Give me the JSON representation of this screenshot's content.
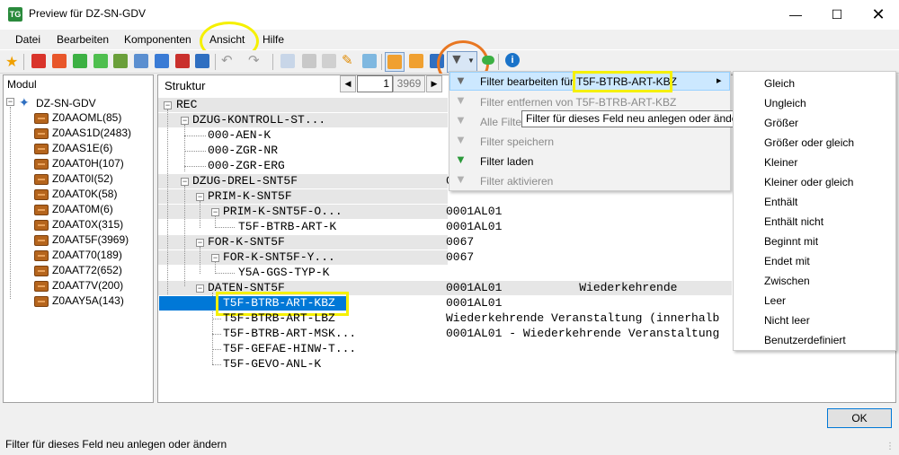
{
  "window": {
    "title": "Preview für DZ-SN-GDV",
    "icon_text": "TG",
    "controls": [
      "minimize-icon",
      "maximize-icon",
      "close-icon"
    ]
  },
  "menu": [
    "Datei",
    "Bearbeiten",
    "Komponenten",
    "Ansicht",
    "Hilfe"
  ],
  "left_panel": {
    "header": "Modul",
    "root": "DZ-SN-GDV",
    "items": [
      "Z0AAOML(85)",
      "Z0AAS1D(2483)",
      "Z0AAS1E(6)",
      "Z0AAT0H(107)",
      "Z0AAT0I(52)",
      "Z0AAT0K(58)",
      "Z0AAT0M(6)",
      "Z0AAT0X(315)",
      "Z0AAT5F(3969)",
      "Z0AAT70(189)",
      "Z0AAT72(652)",
      "Z0AAT7V(200)",
      "Z0AAY5A(143)"
    ]
  },
  "structure": {
    "header": "Struktur",
    "page_current": "1",
    "page_total": "3969",
    "nodes": [
      "REC",
      "DZUG-KONTROLL-ST...",
      "000-AEN-K",
      "000-ZGR-NR",
      "000-ZGR-ERG",
      "DZUG-DREL-SNT5F",
      "PRIM-K-SNT5F",
      "PRIM-K-SNT5F-O...",
      "T5F-BTRB-ART-K",
      "FOR-K-SNT5F",
      "FOR-K-SNT5F-Y...",
      "Y5A-GGS-TYP-K",
      "DATEN-SNT5F",
      "T5F-BTRB-ART-KBZ",
      "T5F-BTRB-ART-LBZ",
      "T5F-BTRB-ART-MSK...",
      "T5F-GEFAE-HINW-T...",
      "T5F-GEVO-ANL-K"
    ],
    "values": [
      "0",
      "0001AL01",
      "0001AL01",
      "0067",
      "0067",
      "0001AL01           Wiederkehrende",
      "0001AL01",
      "Wiederkehrende Veranstaltung (innerhalb",
      "0001AL01 - Wiederkehrende Veranstaltung"
    ]
  },
  "context_menu": {
    "edit_filter": "Filter bearbeiten für T5F-BTRB-ART-KBZ",
    "remove_filter": "Filter entfernen von T5F-BTRB-ART-KBZ",
    "all_filters": "Alle Filte",
    "save_filter": "Filter speichern",
    "load_filter": "Filter laden",
    "activate_filter": "Filter aktivieren",
    "submenu_arrow": "▸"
  },
  "tooltip": "Filter für dieses Feld neu anlegen oder ändern",
  "submenu": [
    "Gleich",
    "Ungleich",
    "Größer",
    "Größer oder gleich",
    "Kleiner",
    "Kleiner oder gleich",
    "Enthält",
    "Enthält nicht",
    "Beginnt mit",
    "Endet mit",
    "Zwischen",
    "Leer",
    "Nicht leer",
    "Benutzerdefiniert"
  ],
  "ok_button": "OK",
  "status": "Filter für dieses Feld neu anlegen oder ändern",
  "colors": {
    "selection": "#0078d7",
    "annotation_yellow": "#f5f000",
    "annotation_orange": "#e87722",
    "folder": "#b5651d"
  }
}
